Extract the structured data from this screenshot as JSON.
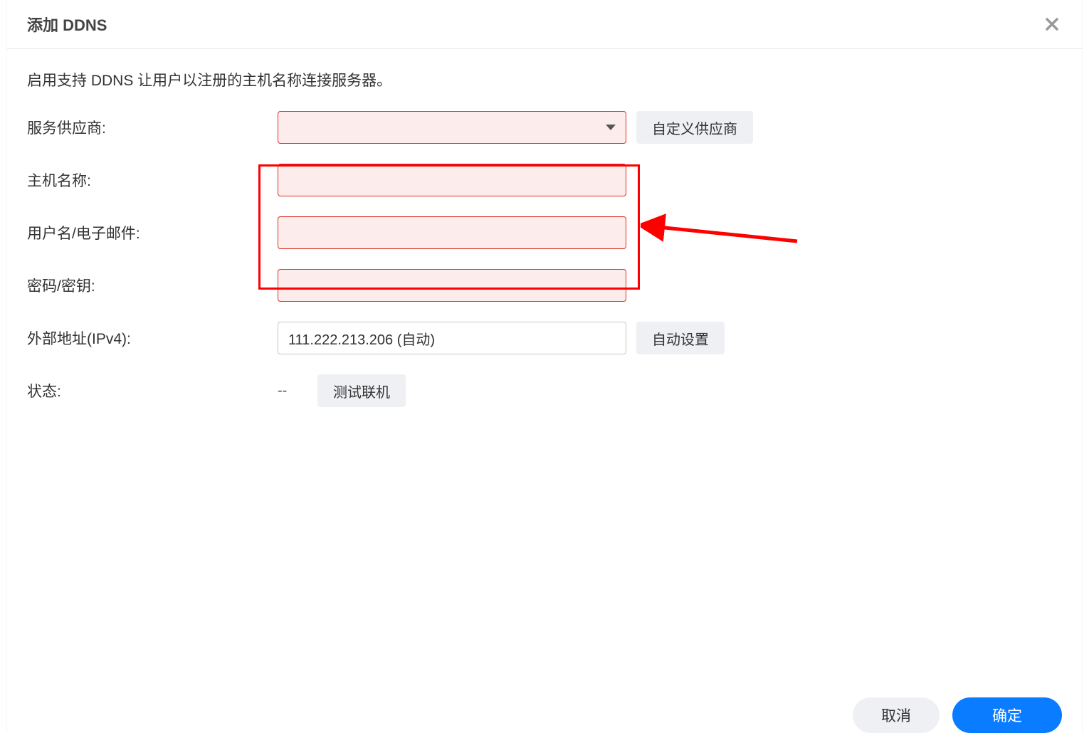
{
  "dialog": {
    "title": "添加 DDNS",
    "description": "启用支持 DDNS 让用户以注册的主机名称连接服务器。"
  },
  "form": {
    "provider_label": "服务供应商:",
    "provider_value": "",
    "custom_provider_btn": "自定义供应商",
    "hostname_label": "主机名称:",
    "hostname_value": "",
    "user_email_label": "用户名/电子邮件:",
    "user_email_value": "",
    "password_label": "密码/密钥:",
    "password_value": "",
    "external_ipv4_label": "外部地址(IPv4):",
    "external_ipv4_value": "111.222.213.206 (自动)",
    "auto_set_btn": "自动设置",
    "status_label": "状态:",
    "status_value": "--",
    "test_connection_btn": "测试联机"
  },
  "footer": {
    "cancel": "取消",
    "ok": "确定"
  }
}
